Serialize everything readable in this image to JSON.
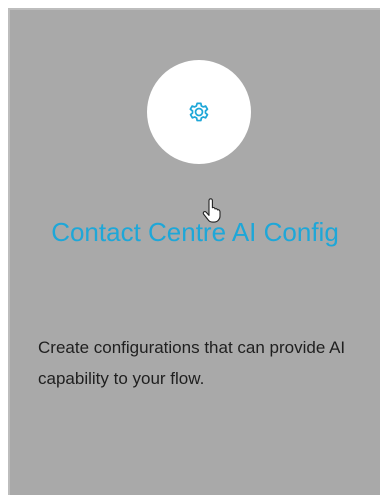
{
  "card": {
    "icon": "gear-icon",
    "title": "Contact Centre AI Config",
    "description": "Create configurations that can provide AI capability to your flow."
  },
  "cursor": {
    "icon": "hand-pointer-icon"
  },
  "colors": {
    "card_background": "#a9a9a9",
    "icon_circle": "#ffffff",
    "accent": "#1ea7d8",
    "text": "#1f1f1f"
  }
}
